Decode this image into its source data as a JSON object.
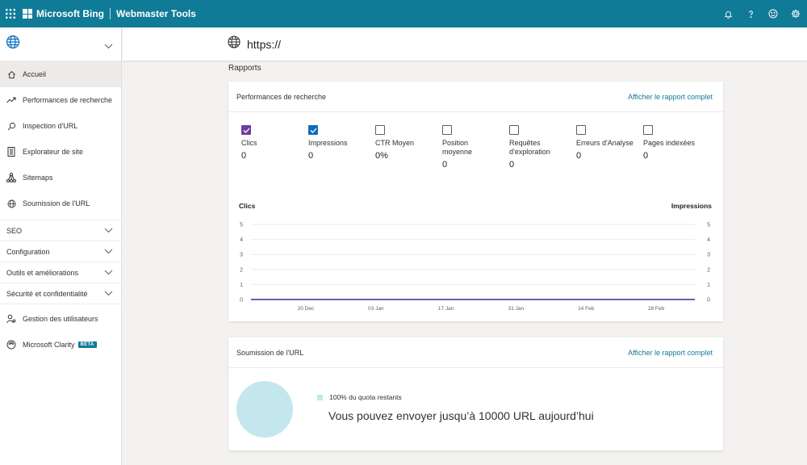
{
  "topbar": {
    "brand": "Microsoft Bing",
    "product": "Webmaster Tools",
    "icons": [
      "waffle-icon",
      "bell-icon",
      "help-icon",
      "feedback-smiley-icon",
      "gear-icon"
    ]
  },
  "header": {
    "url": "https://"
  },
  "sidebar": {
    "items": [
      {
        "label": "Accueil",
        "icon": "home-icon",
        "active": true
      },
      {
        "label": "Performances de recherche",
        "icon": "trend-icon"
      },
      {
        "label": "Inspection d'URL",
        "icon": "search-icon"
      },
      {
        "label": "Explorateur de site",
        "icon": "document-icon"
      },
      {
        "label": "Sitemaps",
        "icon": "sitemap-icon"
      },
      {
        "label": "Soumission de l'URL",
        "icon": "globe-icon"
      }
    ],
    "groups": [
      {
        "label": "SEO"
      },
      {
        "label": "Configuration"
      },
      {
        "label": "Outils et améliorations"
      },
      {
        "label": "Sécurité et confidentialité"
      }
    ],
    "bottom_items": [
      {
        "label": "Gestion des utilisateurs",
        "icon": "users-icon"
      },
      {
        "label": "Microsoft Clarity",
        "icon": "clarity-icon",
        "badge": "BÊTA"
      }
    ]
  },
  "main": {
    "section_title": "Rapports",
    "performance": {
      "title": "Performances de recherche",
      "link": "Afficher le rapport complet",
      "metrics": [
        {
          "label": "Clics",
          "value": "0",
          "checked": true,
          "color": "#6b3fa0"
        },
        {
          "label": "Impressions",
          "value": "0",
          "checked": true,
          "color": "#0f6cbd"
        },
        {
          "label": "CTR Moyen",
          "value": "0%",
          "checked": false
        },
        {
          "label": "Position moyenne",
          "value": "0",
          "checked": false
        },
        {
          "label": "Requêtes d'exploration",
          "value": "0",
          "checked": false
        },
        {
          "label": "Erreurs d'Analyse",
          "value": "0",
          "checked": false
        },
        {
          "label": "Pages indexées",
          "value": "0",
          "checked": false
        }
      ]
    },
    "chart_data": {
      "type": "line",
      "ylabel_left": "Clics",
      "ylabel_right": "Impressions",
      "y_ticks": [
        "5",
        "4",
        "3",
        "2",
        "1",
        "0"
      ],
      "x_ticks": [
        "20 Dec",
        "03 Jan",
        "17 Jan",
        "31 Jan",
        "14 Feb",
        "28 Feb"
      ],
      "ylim": [
        0,
        5
      ],
      "series": [
        {
          "name": "Clics",
          "color": "#6b3fa0",
          "values": [
            0,
            0,
            0,
            0,
            0,
            0
          ]
        },
        {
          "name": "Impressions",
          "color": "#0f6cbd",
          "values": [
            0,
            0,
            0,
            0,
            0,
            0
          ]
        }
      ],
      "grid": true
    },
    "url_submission": {
      "title": "Soumission de l'URL",
      "link": "Afficher le rapport complet",
      "legend": "100% du quota restants",
      "message": "Vous pouvez envoyer jusqu’à 10000 URL aujourd’hui",
      "quota_remaining_fraction": 1.0,
      "pie_color": "#c4e7ee"
    }
  }
}
